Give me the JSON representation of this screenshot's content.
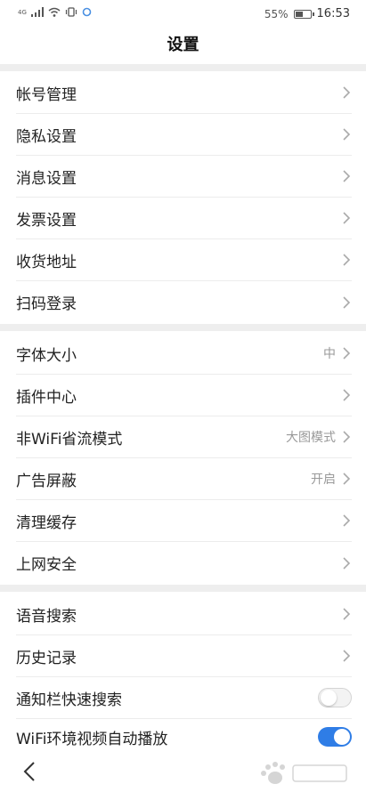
{
  "status": {
    "battery": "55%",
    "battery_level": 0.55,
    "time": "16:53",
    "network": "4G"
  },
  "header": {
    "title": "设置"
  },
  "sections": [
    {
      "items": [
        {
          "label": "帐号管理",
          "value": ""
        },
        {
          "label": "隐私设置",
          "value": ""
        },
        {
          "label": "消息设置",
          "value": ""
        },
        {
          "label": "发票设置",
          "value": ""
        },
        {
          "label": "收货地址",
          "value": ""
        },
        {
          "label": "扫码登录",
          "value": ""
        }
      ]
    },
    {
      "items": [
        {
          "label": "字体大小",
          "value": "中"
        },
        {
          "label": "插件中心",
          "value": ""
        },
        {
          "label": "非WiFi省流模式",
          "value": "大图模式"
        },
        {
          "label": "广告屏蔽",
          "value": "开启"
        },
        {
          "label": "清理缓存",
          "value": ""
        },
        {
          "label": "上网安全",
          "value": ""
        }
      ]
    },
    {
      "items": [
        {
          "label": "语音搜索",
          "value": ""
        },
        {
          "label": "历史记录",
          "value": ""
        },
        {
          "label": "通知栏快速搜索",
          "toggle": false
        },
        {
          "label": "WiFi环境视频自动播放",
          "toggle": true
        }
      ]
    }
  ],
  "colors": {
    "accent": "#2f7de6",
    "divider": "#eeeeee"
  },
  "icons": {
    "back": "chevron-left-icon",
    "row": "chevron-right-icon"
  }
}
